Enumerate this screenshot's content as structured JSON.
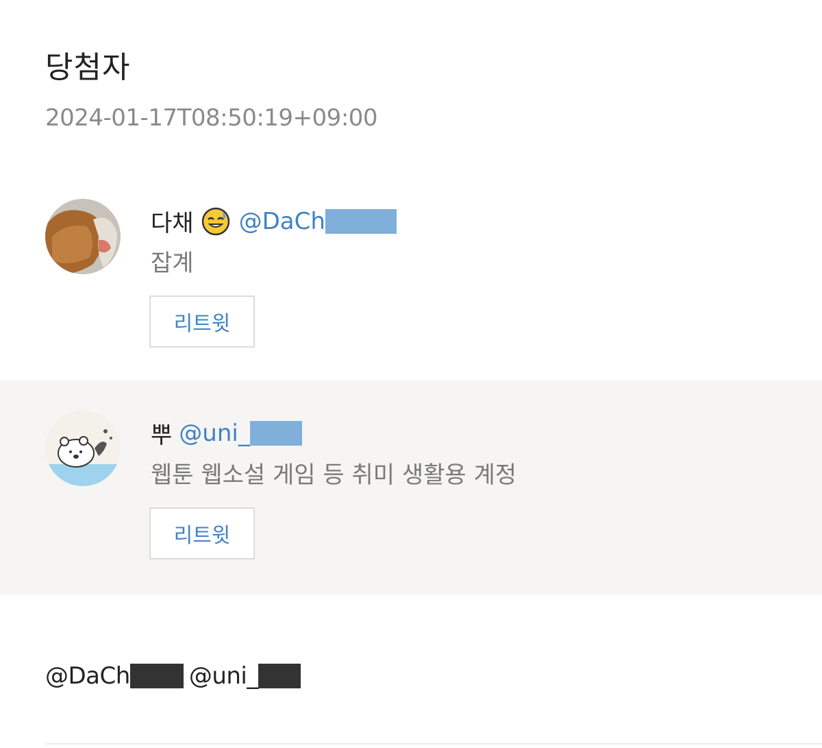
{
  "page": {
    "title": "당첨자",
    "timestamp": "2024-01-17T08:50:19+09:00"
  },
  "winners": [
    {
      "display_name": "다채",
      "emoji_icon": "sweat-smile-emoji",
      "handle_visible": "@DaCh",
      "bio": "잡계",
      "retweet_label": "리트윗",
      "avatar_icon": "bear-plush-photo"
    },
    {
      "display_name": "뿌",
      "handle_visible": "@uni_",
      "bio": "웹툰 웹소설 게임 등 취미 생활용 계정",
      "retweet_label": "리트윗",
      "avatar_icon": "cartoon-bear-illustration"
    }
  ],
  "mentions": {
    "first_visible": "@DaCh",
    "second_visible": "@uni_"
  },
  "colors": {
    "accent": "#3f82c5",
    "muted_text": "#7a7a7a",
    "alt_row_bg": "#f6f5f4",
    "redaction_blue": "#80afd9",
    "redaction_dark": "#333333"
  }
}
